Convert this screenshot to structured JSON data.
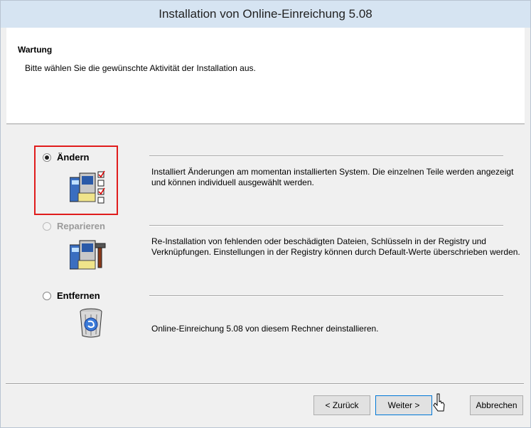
{
  "window": {
    "title": "Installation von Online-Einreichung 5.08"
  },
  "header": {
    "title": "Wartung",
    "subtitle": "Bitte wählen Sie die gewünschte Aktivität der Installation aus."
  },
  "options": [
    {
      "label": "Ändern",
      "selected": true,
      "enabled": true,
      "icon": "modify-icon",
      "description": "Installiert Änderungen am momentan installierten System. Die einzelnen Teile werden angezeigt und können individuell ausgewählt werden."
    },
    {
      "label": "Reparieren",
      "selected": false,
      "enabled": false,
      "icon": "repair-icon",
      "description": "Re-Installation von fehlenden oder beschädigten Dateien, Schlüsseln in der Registry und Verknüpfungen. Einstellungen in der Registry können durch Default-Werte überschrieben werden."
    },
    {
      "label": "Entfernen",
      "selected": false,
      "enabled": true,
      "icon": "remove-icon",
      "description": "Online-Einreichung 5.08 von diesem Rechner deinstallieren."
    }
  ],
  "buttons": {
    "back": "< Zurück",
    "next": "Weiter >",
    "cancel": "Abbrechen"
  },
  "colors": {
    "titlebar": "#d6e4f2",
    "highlight": "#e01c1c"
  }
}
